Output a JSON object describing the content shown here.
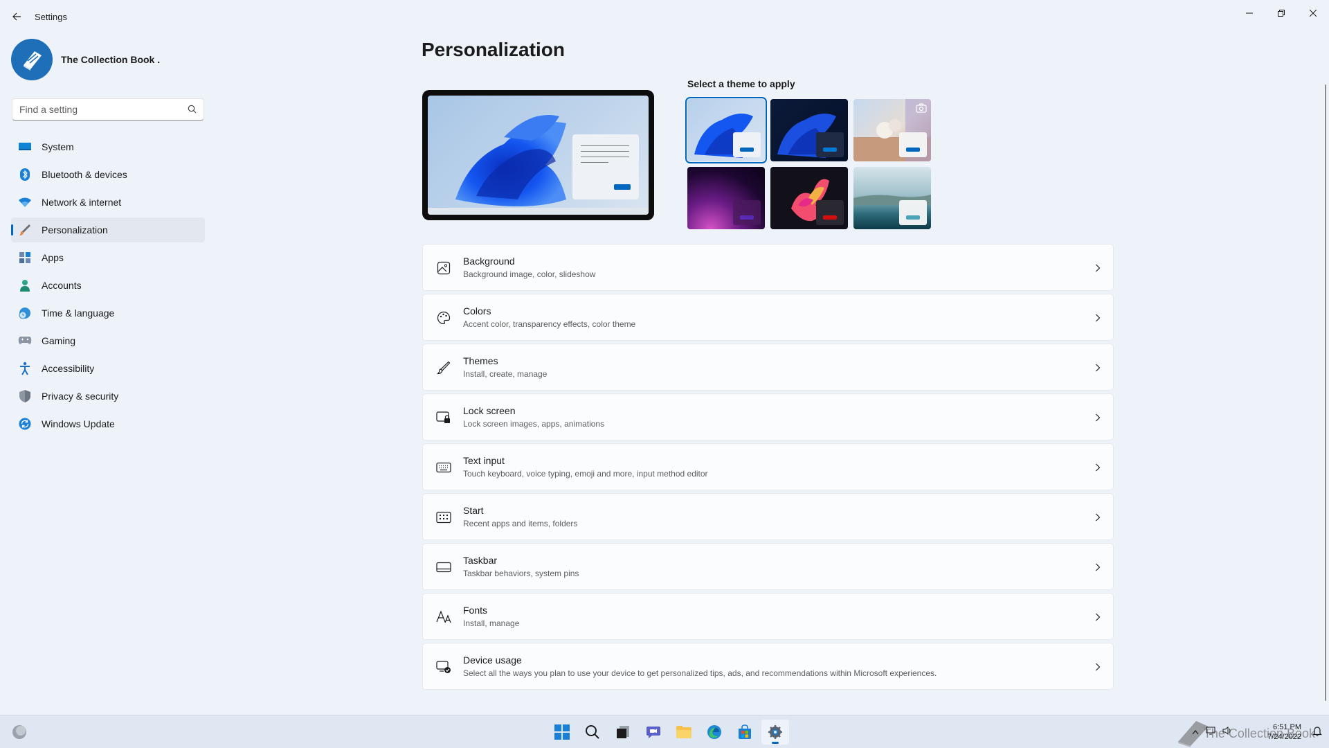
{
  "window": {
    "title": "Settings"
  },
  "profile": {
    "name": "The Collection Book ."
  },
  "search": {
    "placeholder": "Find a setting"
  },
  "sidebar": {
    "items": [
      {
        "label": "System",
        "icon": "monitor-icon"
      },
      {
        "label": "Bluetooth & devices",
        "icon": "bluetooth-icon"
      },
      {
        "label": "Network & internet",
        "icon": "wifi-icon"
      },
      {
        "label": "Personalization",
        "icon": "brush-icon",
        "active": true
      },
      {
        "label": "Apps",
        "icon": "apps-icon"
      },
      {
        "label": "Accounts",
        "icon": "person-icon"
      },
      {
        "label": "Time & language",
        "icon": "globe-clock-icon"
      },
      {
        "label": "Gaming",
        "icon": "gamepad-icon"
      },
      {
        "label": "Accessibility",
        "icon": "accessibility-icon"
      },
      {
        "label": "Privacy & security",
        "icon": "shield-icon"
      },
      {
        "label": "Windows Update",
        "icon": "update-icon"
      }
    ]
  },
  "main": {
    "title": "Personalization",
    "theme_label": "Select a theme to apply",
    "rows": [
      {
        "title": "Background",
        "subtitle": "Background image, color, slideshow",
        "icon": "image-icon"
      },
      {
        "title": "Colors",
        "subtitle": "Accent color, transparency effects, color theme",
        "icon": "palette-icon"
      },
      {
        "title": "Themes",
        "subtitle": "Install, create, manage",
        "icon": "brush-icon"
      },
      {
        "title": "Lock screen",
        "subtitle": "Lock screen images, apps, animations",
        "icon": "lock-screen-icon"
      },
      {
        "title": "Text input",
        "subtitle": "Touch keyboard, voice typing, emoji and more, input method editor",
        "icon": "keyboard-icon"
      },
      {
        "title": "Start",
        "subtitle": "Recent apps and items, folders",
        "icon": "start-icon"
      },
      {
        "title": "Taskbar",
        "subtitle": "Taskbar behaviors, system pins",
        "icon": "taskbar-icon"
      },
      {
        "title": "Fonts",
        "subtitle": "Install, manage",
        "icon": "fonts-icon"
      },
      {
        "title": "Device usage",
        "subtitle": "Select all the ways you plan to use your device to get personalized tips, ads, and recommendations within Microsoft experiences.",
        "icon": "device-usage-icon"
      }
    ]
  },
  "taskbar": {
    "time": "6:51 PM",
    "date": "7/24/2022",
    "watermark": "The Collection Book"
  },
  "colors": {
    "accent": "#0067c0",
    "background": "#eef3fa"
  }
}
